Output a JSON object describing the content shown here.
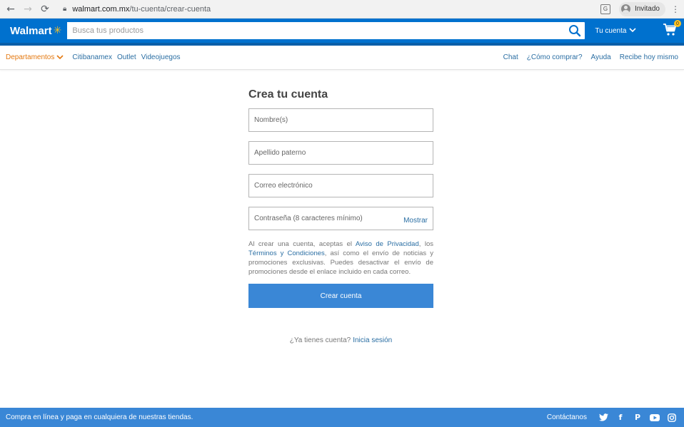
{
  "browser": {
    "back_icon": "←",
    "forward_icon": "→",
    "reload_icon": "⟳",
    "url_host": "walmart.com.mx",
    "url_path": "/tu-cuenta/crear-cuenta",
    "profile_label": "Invitado",
    "menu_icon": "⋮"
  },
  "header": {
    "logo_text": "Walmart",
    "search_placeholder": "Busca tus productos",
    "account_label": "Tu cuenta",
    "cart_count": "0",
    "brand_color": "#0071ce",
    "spark_color": "#ffc220"
  },
  "subnav": {
    "departments": "Departamentos",
    "left_links": [
      "Citibanamex",
      "Outlet",
      "Videojuegos"
    ],
    "right_links": [
      "Chat",
      "¿Cómo comprar?",
      "Ayuda",
      "Recibe hoy mismo"
    ]
  },
  "form": {
    "title": "Crea tu cuenta",
    "first_name_placeholder": "Nombre(s)",
    "last_name_placeholder": "Apellido paterno",
    "email_placeholder": "Correo electrónico",
    "password_placeholder": "Contraseña (8 caracteres mínimo)",
    "show_label": "Mostrar",
    "legal_1": "Al crear una cuenta, aceptas el ",
    "privacy_link": "Aviso de Privacidad",
    "legal_2": ", los ",
    "terms_link": "Términos y Condiciones",
    "legal_3": ", así como el envío de noticias y promociones exclusivas. Puedes desactivar el envío de promociones desde el enlace incluido en cada correo.",
    "submit_label": "Crear cuenta",
    "have_account": "¿Ya tienes cuenta?",
    "login_link": "Inicia sesión"
  },
  "footer": {
    "tagline": "Compra en línea y paga en cualquiera de nuestras tiendas.",
    "contact_label": "Contáctanos",
    "social_icons": [
      "twitter-icon",
      "facebook-icon",
      "pinterest-icon",
      "youtube-icon",
      "instagram-icon"
    ]
  }
}
